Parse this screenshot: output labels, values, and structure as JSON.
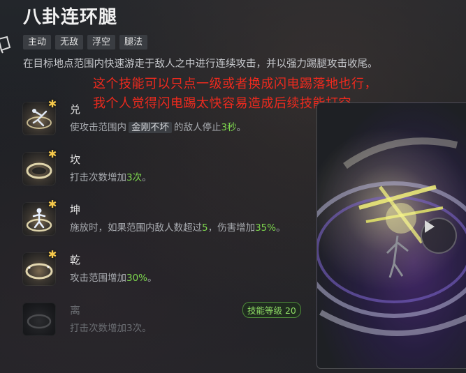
{
  "skill": {
    "title": "八卦连环腿",
    "tags": [
      "主动",
      "无敌",
      "浮空",
      "腿法"
    ],
    "description": "在目标地点范围内快速游走于敌人之中进行连续攻击，并以强力踢腿攻击收尾。"
  },
  "annotation": {
    "line1": "这个技能可以只点一级或者换成闪电踢落地也行，",
    "line2": "我个人觉得闪电踢太快容易造成后续技能打空。",
    "color": "#ee2a1e"
  },
  "upgrades": [
    {
      "name": "兑",
      "effect_pre": "使攻击范围内",
      "effect_keyword": "金刚不坏",
      "effect_mid": "的敌人停止",
      "effect_value": "3秒",
      "effect_post": "。",
      "icon": "dancer-icon",
      "selected": true
    },
    {
      "name": "坎",
      "effect_pre": "打击次数增加",
      "effect_value": "3次",
      "effect_post": "。",
      "icon": "ring-icon",
      "selected": true
    },
    {
      "name": "坤",
      "effect_pre": "施放时，如果范围内敌人数超过",
      "effect_value": "5",
      "effect_mid": "，伤害增加",
      "effect_value2": "35%",
      "effect_post": "。",
      "icon": "figure-ring-icon",
      "selected": true
    },
    {
      "name": "乾",
      "effect_pre": "攻击范围增加",
      "effect_value": "30%",
      "effect_post": "。",
      "icon": "ring-icon",
      "selected": true
    },
    {
      "name": "离",
      "effect_text": "打击次数增加3次。",
      "icon": "ring-icon",
      "selected": false,
      "requirement": "技能等级 20"
    }
  ],
  "star_glyph": "✱",
  "colors": {
    "highlight": "#7ed84e",
    "star": "#f6c94c",
    "badge_border": "#4e8a3a"
  },
  "preview": {
    "play_icon": "play-icon"
  }
}
